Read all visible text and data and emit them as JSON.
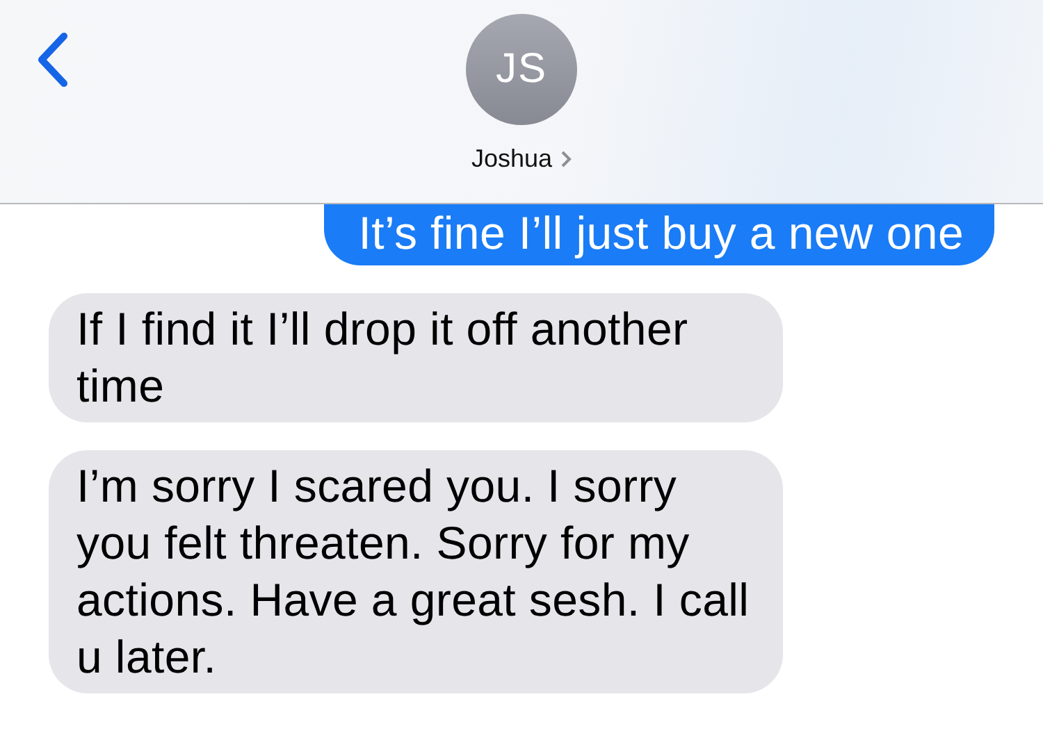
{
  "header": {
    "contact": {
      "initials": "JS",
      "name": "Joshua"
    }
  },
  "messages": [
    {
      "kind": "sent",
      "text": "It’s fine I’ll just buy a new one"
    },
    {
      "kind": "received",
      "text": "If I find it I’ll drop it off another time"
    },
    {
      "kind": "received",
      "text": "I’m sorry I scared you. I sorry you felt threaten. Sorry for my actions. Have a great sesh. I call u later."
    }
  ]
}
